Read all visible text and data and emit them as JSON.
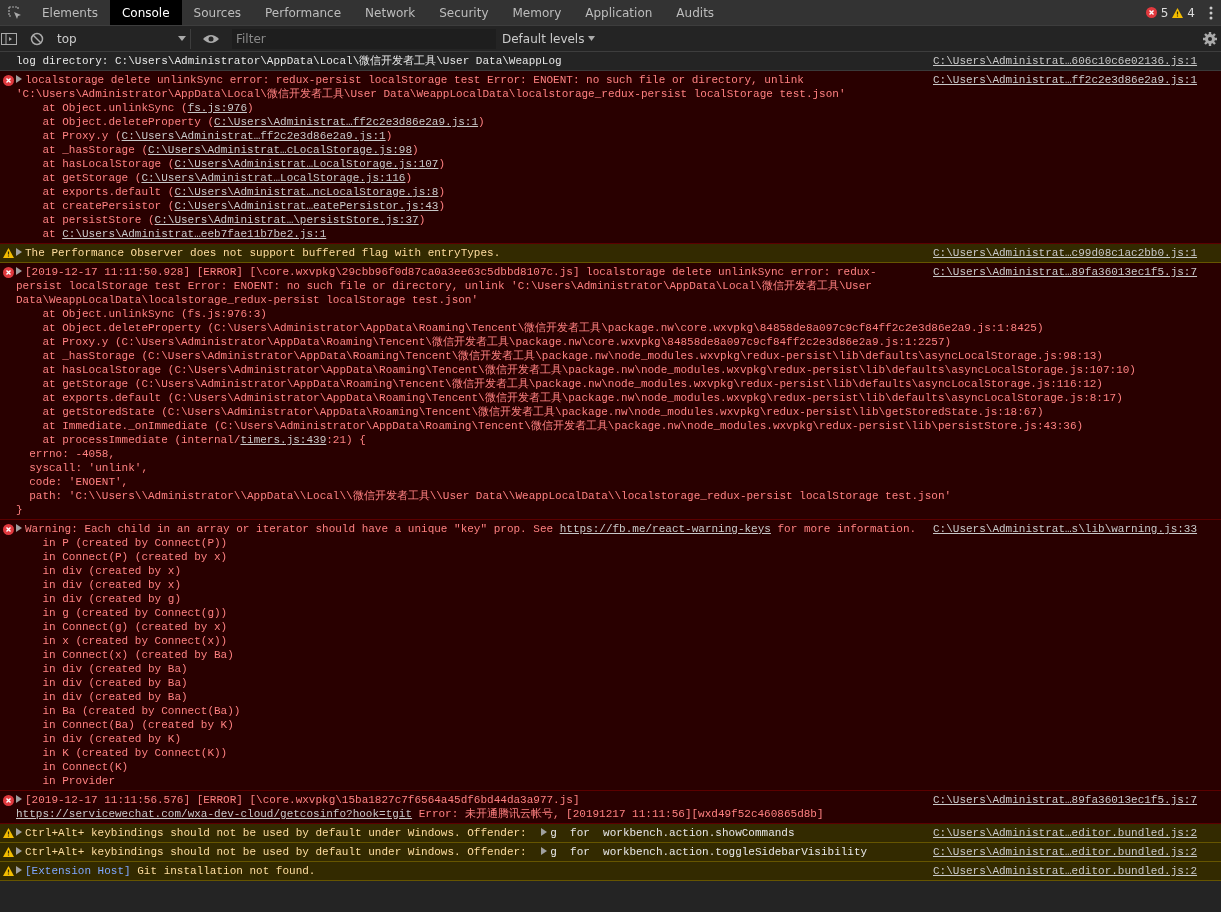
{
  "tabs": [
    {
      "label": "Elements",
      "selected": false
    },
    {
      "label": "Console",
      "selected": true
    },
    {
      "label": "Sources",
      "selected": false
    },
    {
      "label": "Performance",
      "selected": false
    },
    {
      "label": "Network",
      "selected": false
    },
    {
      "label": "Security",
      "selected": false
    },
    {
      "label": "Memory",
      "selected": false
    },
    {
      "label": "Application",
      "selected": false
    },
    {
      "label": "Audits",
      "selected": false
    }
  ],
  "counts": {
    "errors": "5",
    "warnings": "4"
  },
  "toolbar": {
    "context": "top",
    "filter_placeholder": "Filter",
    "levels": "Default levels"
  },
  "messages": [
    {
      "kind": "log",
      "expandable": false,
      "text": "log directory: C:\\Users\\Administrator\\AppData\\Local\\微信开发者工具\\User Data\\WeappLog",
      "source": "C:\\Users\\Administrat…606c10c6e02136.js:1"
    },
    {
      "kind": "error",
      "expandable": true,
      "text": "localstorage delete unlinkSync error: redux-persist localStorage test Error: ENOENT: no such file or directory, unlink 'C:\\Users\\Administrator\\AppData\\Local\\微信开发者工具\\User Data\\WeappLocalData\\localstorage_redux-persist localStorage test.json'",
      "source": "C:\\Users\\Administrat…ff2c2e3d86e2a9.js:1",
      "stack": [
        {
          "kind": "frame",
          "text": "at Object.unlinkSync (",
          "link": "fs.js:976",
          "after": ")"
        },
        {
          "kind": "frame",
          "text": "at Object.deleteProperty (",
          "link": "C:\\Users\\Administrat…ff2c2e3d86e2a9.js:1",
          "after": ")"
        },
        {
          "kind": "frame",
          "text": "at Proxy.y (",
          "link": "C:\\Users\\Administrat…ff2c2e3d86e2a9.js:1",
          "after": ")"
        },
        {
          "kind": "frame",
          "text": "at _hasStorage (",
          "link": "C:\\Users\\Administrat…cLocalStorage.js:98",
          "after": ")"
        },
        {
          "kind": "frame",
          "text": "at hasLocalStorage (",
          "link": "C:\\Users\\Administrat…LocalStorage.js:107",
          "after": ")"
        },
        {
          "kind": "frame",
          "text": "at getStorage (",
          "link": "C:\\Users\\Administrat…LocalStorage.js:116",
          "after": ")"
        },
        {
          "kind": "frame",
          "text": "at exports.default (",
          "link": "C:\\Users\\Administrat…ncLocalStorage.js:8",
          "after": ")"
        },
        {
          "kind": "frame",
          "text": "at createPersistor (",
          "link": "C:\\Users\\Administrat…eatePersistor.js:43",
          "after": ")"
        },
        {
          "kind": "frame",
          "text": "at persistStore (",
          "link": "C:\\Users\\Administrat…\\persistStore.js:37",
          "after": ")"
        },
        {
          "kind": "frame",
          "text": "at ",
          "link": "C:\\Users\\Administrat…eeb7fae11b7be2.js:1"
        }
      ]
    },
    {
      "kind": "warning",
      "expandable": true,
      "text": "The Performance Observer does not support buffered flag with entryTypes.",
      "source": "C:\\Users\\Administrat…c99d08c1ac2bb0.js:1"
    },
    {
      "kind": "error",
      "expandable": true,
      "text": "[2019-12-17 11:11:50.928] [ERROR] [\\core.wxvpkg\\29cbb96f0d87ca0a3ee63c5dbbd8107c.js] localstorage delete unlinkSync error: redux-persist localStorage test Error: ENOENT: no such file or directory, unlink 'C:\\Users\\Administrator\\AppData\\Local\\微信开发者工具\\User Data\\WeappLocalData\\localstorage_redux-persist localStorage test.json'",
      "source": "C:\\Users\\Administrat…89fa36013ec1f5.js:7",
      "stack": [
        {
          "kind": "frame",
          "text": "at Object.unlinkSync (fs.js:976:3)"
        },
        {
          "kind": "frame",
          "text": "at Object.deleteProperty (C:\\Users\\Administrator\\AppData\\Roaming\\Tencent\\微信开发者工具\\package.nw\\core.wxvpkg\\84858de8a097c9cf84ff2c2e3d86e2a9.js:1:8425)"
        },
        {
          "kind": "frame",
          "text": "at Proxy.y (C:\\Users\\Administrator\\AppData\\Roaming\\Tencent\\微信开发者工具\\package.nw\\core.wxvpkg\\84858de8a097c9cf84ff2c2e3d86e2a9.js:1:2257)"
        },
        {
          "kind": "frame",
          "text": "at _hasStorage (C:\\Users\\Administrator\\AppData\\Roaming\\Tencent\\微信开发者工具\\package.nw\\node_modules.wxvpkg\\redux-persist\\lib\\defaults\\asyncLocalStorage.js:98:13)"
        },
        {
          "kind": "frame",
          "text": "at hasLocalStorage (C:\\Users\\Administrator\\AppData\\Roaming\\Tencent\\微信开发者工具\\package.nw\\node_modules.wxvpkg\\redux-persist\\lib\\defaults\\asyncLocalStorage.js:107:10)"
        },
        {
          "kind": "frame",
          "text": "at getStorage (C:\\Users\\Administrator\\AppData\\Roaming\\Tencent\\微信开发者工具\\package.nw\\node_modules.wxvpkg\\redux-persist\\lib\\defaults\\asyncLocalStorage.js:116:12)"
        },
        {
          "kind": "frame",
          "text": "at exports.default (C:\\Users\\Administrator\\AppData\\Roaming\\Tencent\\微信开发者工具\\package.nw\\node_modules.wxvpkg\\redux-persist\\lib\\defaults\\asyncLocalStorage.js:8:17)"
        },
        {
          "kind": "frame",
          "text": "at getStoredState (C:\\Users\\Administrator\\AppData\\Roaming\\Tencent\\微信开发者工具\\package.nw\\node_modules.wxvpkg\\redux-persist\\lib\\getStoredState.js:18:67)"
        },
        {
          "kind": "frame",
          "text": "at Immediate._onImmediate (C:\\Users\\Administrator\\AppData\\Roaming\\Tencent\\微信开发者工具\\package.nw\\node_modules.wxvpkg\\redux-persist\\lib\\persistStore.js:43:36)"
        },
        {
          "kind": "frame",
          "text": "at processImmediate (internal/",
          "link": "timers.js:439",
          "after": ":21) {"
        },
        {
          "kind": "prop",
          "text": "errno: -4058,"
        },
        {
          "kind": "prop",
          "text": "syscall: 'unlink',"
        },
        {
          "kind": "prop",
          "text": "code: 'ENOENT',"
        },
        {
          "kind": "prop",
          "text": "path: 'C:\\\\Users\\\\Administrator\\\\AppData\\\\Local\\\\微信开发者工具\\\\User Data\\\\WeappLocalData\\\\localstorage_redux-persist localStorage test.json'"
        },
        {
          "kind": "close",
          "text": "}"
        }
      ]
    },
    {
      "kind": "error",
      "expandable": true,
      "text": "Warning: Each child in an array or iterator should have a unique \"key\" prop. See ",
      "link": "https://fb.me/react-warning-keys",
      "after": " for more information.",
      "source": "C:\\Users\\Administrat…s\\lib\\warning.js:33",
      "stack": [
        {
          "kind": "frame",
          "text": "in P (created by Connect(P))"
        },
        {
          "kind": "frame",
          "text": "in Connect(P) (created by x)"
        },
        {
          "kind": "frame",
          "text": "in div (created by x)"
        },
        {
          "kind": "frame",
          "text": "in div (created by x)"
        },
        {
          "kind": "frame",
          "text": "in div (created by g)"
        },
        {
          "kind": "frame",
          "text": "in g (created by Connect(g))"
        },
        {
          "kind": "frame",
          "text": "in Connect(g) (created by x)"
        },
        {
          "kind": "frame",
          "text": "in x (created by Connect(x))"
        },
        {
          "kind": "frame",
          "text": "in Connect(x) (created by Ba)"
        },
        {
          "kind": "frame",
          "text": "in div (created by Ba)"
        },
        {
          "kind": "frame",
          "text": "in div (created by Ba)"
        },
        {
          "kind": "frame",
          "text": "in div (created by Ba)"
        },
        {
          "kind": "frame",
          "text": "in Ba (created by Connect(Ba))"
        },
        {
          "kind": "frame",
          "text": "in Connect(Ba) (created by K)"
        },
        {
          "kind": "frame",
          "text": "in div (created by K)"
        },
        {
          "kind": "frame",
          "text": "in K (created by Connect(K))"
        },
        {
          "kind": "frame",
          "text": "in Connect(K)"
        },
        {
          "kind": "frame",
          "text": "in Provider"
        }
      ]
    },
    {
      "kind": "error",
      "expandable": true,
      "text": "[2019-12-17 11:11:56.576] [ERROR] [\\core.wxvpkg\\15ba1827c7f6564a45df6bd44da3a977.js] ",
      "link": "https://servicewechat.com/wxa-dev-cloud/getcosinfo?hook=tgit",
      "after": " Error: 未开通腾讯云帐号, [20191217 11:11:56][wxd49f52c460865d8b]",
      "source": "C:\\Users\\Administrat…89fa36013ec1f5.js:7"
    },
    {
      "kind": "warning",
      "expandable": true,
      "text": "Ctrl+Alt+ keybindings should not be used by default under Windows. Offender: ",
      "object": "g  for  workbench.action.showCommands",
      "source": "C:\\Users\\Administrat…editor.bundled.js:2"
    },
    {
      "kind": "warning",
      "expandable": true,
      "text": "Ctrl+Alt+ keybindings should not be used by default under Windows. Offender: ",
      "object": "g  for  workbench.action.toggleSidebarVisibility",
      "source": "C:\\Users\\Administrat…editor.bundled.js:2"
    },
    {
      "kind": "warning",
      "expandable": true,
      "tag": "[Extension Host]",
      "text": " Git installation not found.",
      "source": "C:\\Users\\Administrat…editor.bundled.js:2"
    }
  ]
}
